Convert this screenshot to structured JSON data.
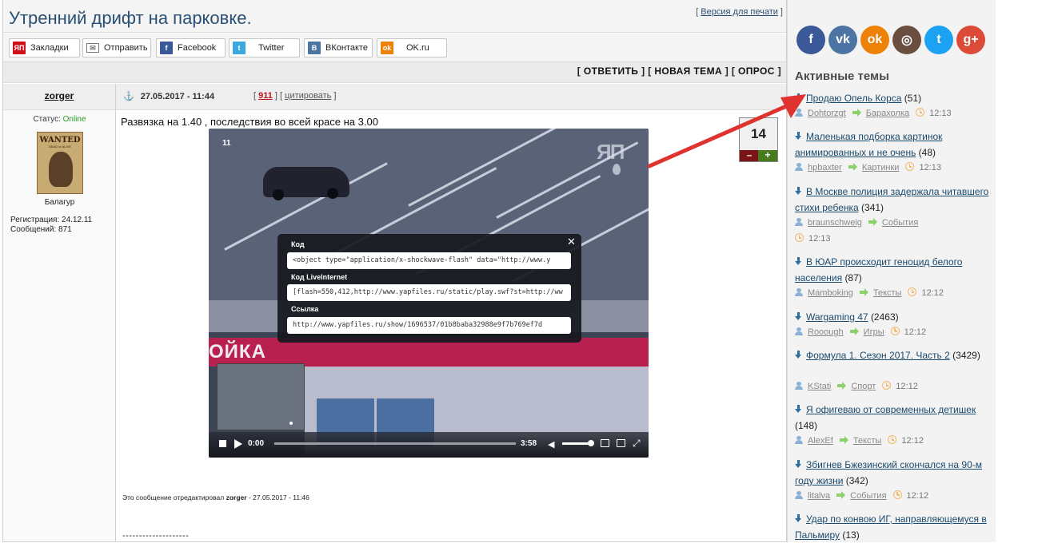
{
  "topic": {
    "title": "Утренний дрифт на парковке.",
    "print_link": "Версия для печати"
  },
  "share_buttons": [
    {
      "label": "Закладки",
      "icon": "yap-icon",
      "color": "#d0101b"
    },
    {
      "label": "Отправить",
      "icon": "mail-icon",
      "color": "#888888"
    },
    {
      "label": "Facebook",
      "icon": "facebook-icon",
      "color": "#3b5998"
    },
    {
      "label": "Twitter",
      "icon": "twitter-icon",
      "color": "#39a9e0"
    },
    {
      "label": "ВКонтакте",
      "icon": "vk-icon",
      "color": "#4c75a3"
    },
    {
      "label": "OK.ru",
      "icon": "odnoklassniki-icon",
      "color": "#ee8208"
    }
  ],
  "actions": {
    "reply": "ОТВЕТИТЬ",
    "new_topic": "НОВАЯ ТЕМА",
    "poll": "ОПРОС"
  },
  "post": {
    "author": "zorger",
    "datetime": "27.05.2017 - 11:44",
    "number": "911",
    "quote": "цитировать",
    "status_label": "Статус:",
    "status_value": "Online",
    "avatar_word": "WANTED",
    "avatar_sub": "DEAD or ALIVE",
    "rank": "Балагур",
    "reg_label": "Регистрация:",
    "reg_value": "24.12.11",
    "msgs_label": "Сообщений:",
    "msgs_value": "871",
    "text": "Развязка на 1.40 , последствия во всей красе на 3.00",
    "rating": "14",
    "rating_minus": "–",
    "rating_plus": "+",
    "edited_prefix": "Это сообщение отредактировал",
    "edited_by": "zorger",
    "edited_time": " - 27.05.2017 - 11:46",
    "separator": "--------------------"
  },
  "video": {
    "index": "11",
    "logo": "ЯП",
    "sign_text": "ОЙКА",
    "current_time": "0:00",
    "duration": "3:58",
    "progress": 0,
    "volume": 0.9,
    "embed": {
      "code_label": "Код",
      "code_value": "<object type=\"application/x-shockwave-flash\" data=\"http://www.y",
      "li_label": "Код LiveInternet",
      "li_value": "[flash=550,412,http://www.yapfiles.ru/static/play.swf?st=http://ww",
      "link_label": "Ссылка",
      "link_value": "http://www.yapfiles.ru/show/1696537/01b8baba32988e9f7b769ef7d"
    }
  },
  "sidebar": {
    "social": [
      {
        "name": "facebook-icon",
        "glyph": "f",
        "color": "#3b5998"
      },
      {
        "name": "vk-icon",
        "glyph": "vk",
        "color": "#4c75a3"
      },
      {
        "name": "odnoklassniki-icon",
        "glyph": "ok",
        "color": "#ee8208"
      },
      {
        "name": "instagram-icon",
        "glyph": "◎",
        "color": "#6a4e3f"
      },
      {
        "name": "twitter-icon",
        "glyph": "t",
        "color": "#1da1f2"
      },
      {
        "name": "googleplus-icon",
        "glyph": "g+",
        "color": "#dc4a38"
      }
    ],
    "heading": "Активные темы",
    "topics": [
      {
        "title": "Продаю Опель Корса",
        "count": "(51)",
        "user": "Dohtorzgt",
        "category": "Барахолка",
        "time": "12:13"
      },
      {
        "title": "Маленькая подборка картинок анимированных и не очень",
        "count": "(48)",
        "user": "hpbaxter",
        "category": "Картинки",
        "time": "12:13"
      },
      {
        "title": "В Москве полиция задержала читавшего стихи ребенка",
        "count": "(341)",
        "user": "braunschweig",
        "category": "События",
        "time": "12:13"
      },
      {
        "title": "В ЮАР происходит геноцид белого населения",
        "count": "(87)",
        "user": "Mamboking",
        "category": "Тексты",
        "time": "12:12"
      },
      {
        "title": "Wargaming 47",
        "count": "(2463)",
        "user": "Rooough",
        "category": "Игры",
        "time": "12:12"
      },
      {
        "title": "Формула 1. Сезон 2017. Часть 2",
        "count": "(3429)",
        "user": "KStati",
        "category": "Спорт",
        "time": "12:12"
      },
      {
        "title": "Я офигеваю от современных детишек",
        "count": "(148)",
        "user": "AlexEf",
        "category": "Тексты",
        "time": "12:12"
      },
      {
        "title": "Збигнев Бжезинский скончался на 90-м году жизни",
        "count": "(342)",
        "user": "litalva",
        "category": "События",
        "time": "12:12"
      },
      {
        "title": "Удар по конвою ИГ, направляющемуся в Пальмиру",
        "count": "(13)",
        "user": "",
        "category": "",
        "time": ""
      }
    ]
  },
  "colors": {
    "title": "#2a4f74",
    "link": "#1a4a6e",
    "annotation_arrow": "#e0332f",
    "online": "#229922"
  }
}
